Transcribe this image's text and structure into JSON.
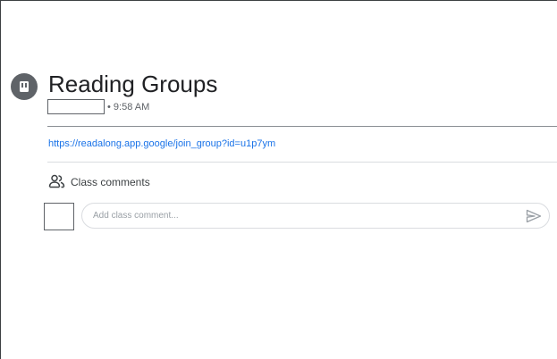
{
  "post": {
    "icon": "book-icon",
    "title": "Reading Groups",
    "author": "",
    "time": "• 9:58 AM",
    "link": "https://readalong.app.google/join_group?id=u1p7ym"
  },
  "comments": {
    "icon": "people-icon",
    "label": "Class comments",
    "placeholder": "Add class comment...",
    "send_icon": "send-icon"
  },
  "colors": {
    "link": "#1a73e8",
    "icon": "#5f6368",
    "text": "#202124"
  }
}
